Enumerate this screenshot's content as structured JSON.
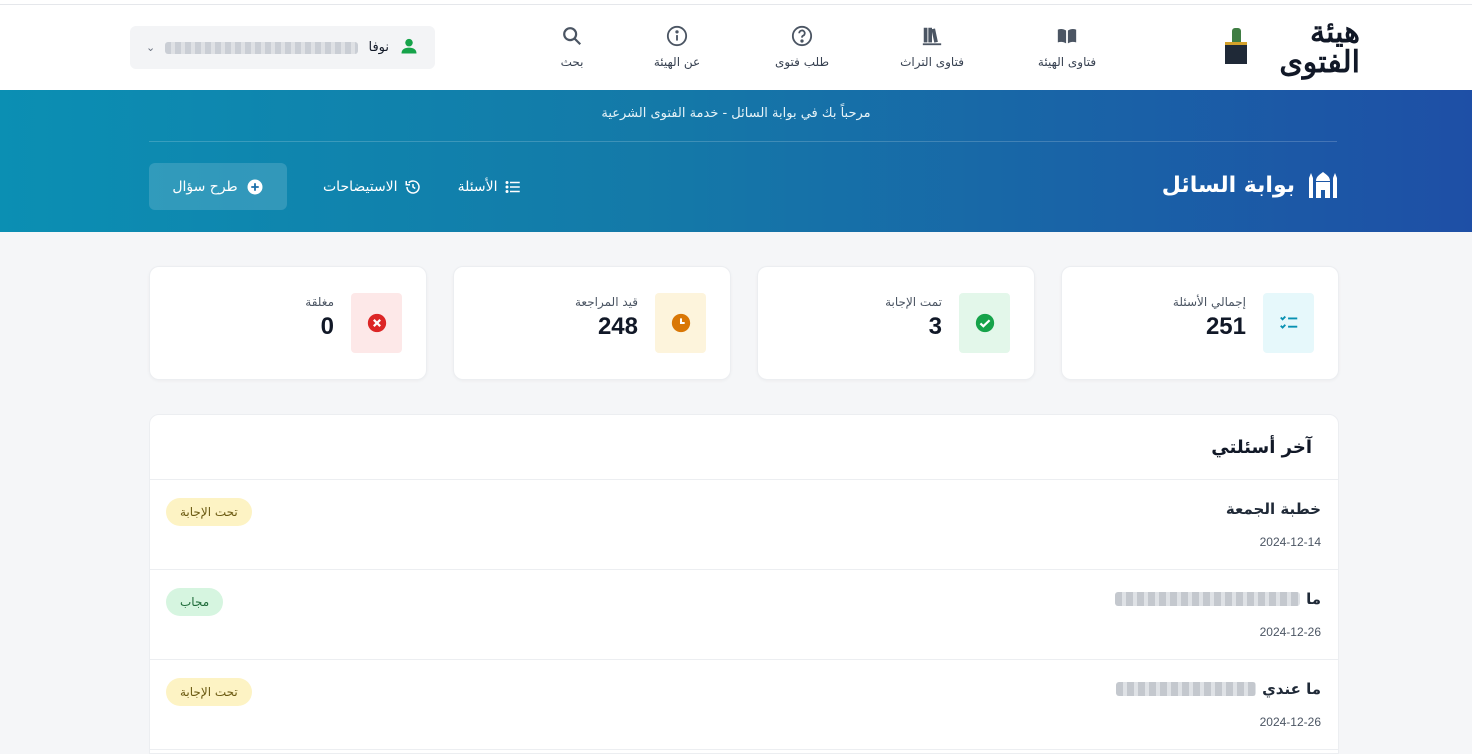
{
  "header": {
    "logo_text": "هيئة الفتوى",
    "nav": [
      {
        "label": "فتاوى الهيئة",
        "icon": "open-book-icon"
      },
      {
        "label": "فتاوى التراث",
        "icon": "books-icon"
      },
      {
        "label": "طلب فتوى",
        "icon": "question-circle-icon"
      },
      {
        "label": "عن الهيئة",
        "icon": "info-circle-icon"
      },
      {
        "label": "بحث",
        "icon": "search-icon"
      }
    ],
    "user": {
      "name": "نوفا"
    }
  },
  "banner": {
    "welcome": "مرحباً بك في بوابة السائل - خدمة الفتوى الشرعية",
    "title": "بوابة السائل",
    "links": {
      "questions": "الأسئلة",
      "clarifications": "الاستيضاحات",
      "ask": "طرح سؤال"
    }
  },
  "stats": [
    {
      "label": "إجمالي الأسئلة",
      "value": "251",
      "color": "#0891b2",
      "bg": "#e6f8fb",
      "icon": "checklist-icon"
    },
    {
      "label": "تمت الإجابة",
      "value": "3",
      "color": "#16a34a",
      "bg": "#e3f7ea",
      "icon": "check-circle-icon"
    },
    {
      "label": "قيد المراجعة",
      "value": "248",
      "color": "#d97706",
      "bg": "#fdf4dc",
      "icon": "clock-icon"
    },
    {
      "label": "مغلقة",
      "value": "0",
      "color": "#dc2626",
      "bg": "#fde8e8",
      "icon": "x-circle-icon"
    }
  ],
  "recent": {
    "title": "آخر أسئلتي",
    "items": [
      {
        "title": "خطبة الجمعة",
        "date": "2024-12-14",
        "status": "تحت الإجابة"
      },
      {
        "title": "ما",
        "date": "2024-12-26",
        "status": "مجاب"
      },
      {
        "title": "ما عندي",
        "date": "2024-12-26",
        "status": "تحت الإجابة"
      }
    ]
  }
}
